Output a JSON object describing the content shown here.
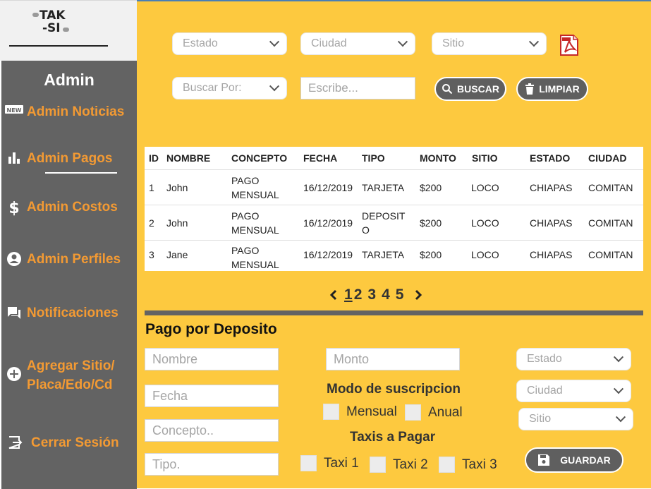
{
  "logo": {
    "line1": "TAK",
    "line2": "-SI"
  },
  "sidebar": {
    "title": "Admin",
    "items": [
      {
        "label": "Admin Noticias",
        "icon": "new-badge-icon"
      },
      {
        "label": "Admin Pagos",
        "icon": "bar-chart-icon"
      },
      {
        "label": "Admin Costos",
        "icon": "dollar-icon"
      },
      {
        "label": "Admin Perfiles",
        "icon": "account-circle-icon"
      },
      {
        "label": "Notificaciones",
        "icon": "chat-bubble-icon"
      },
      {
        "label": "Agregar Sitio/ Placa/Edo/Cd",
        "icon": "add-circle-icon"
      },
      {
        "label": "Cerrar Sesión",
        "icon": "logout-icon"
      }
    ],
    "active_index": 1
  },
  "filters": {
    "estado": "Estado",
    "ciudad": "Ciudad",
    "sitio": "Sitio",
    "buscar_por": "Buscar Por:",
    "search_placeholder": "Escribe...",
    "buscar_label": "BUSCAR",
    "limpiar_label": "LIMPIAR"
  },
  "table": {
    "headers": [
      "ID",
      "NOMBRE",
      "CONCEPTO",
      "FECHA",
      "TIPO",
      "MONTO",
      "SITIO",
      "ESTADO",
      "CIUDAD"
    ],
    "rows": [
      {
        "id": "1",
        "nombre": "John",
        "concepto_1": "PAGO",
        "concepto_2": "MENSUAL",
        "fecha": "16/12/2019",
        "tipo_1": "TARJETA",
        "tipo_2": "",
        "monto": "$200",
        "sitio": "LOCO",
        "estado": "CHIAPAS",
        "ciudad": "COMITAN"
      },
      {
        "id": "2",
        "nombre": "John",
        "concepto_1": "PAGO",
        "concepto_2": "MENSUAL",
        "fecha": "16/12/2019",
        "tipo_1": "DEPOSIT",
        "tipo_2": "O",
        "monto": "$200",
        "sitio": "LOCO",
        "estado": "CHIAPAS",
        "ciudad": "COMITAN"
      },
      {
        "id": "3",
        "nombre": "Jane",
        "concepto_1": "PAGO",
        "concepto_2": "MENSUAL",
        "fecha": "16/12/2019",
        "tipo_1": "TARJETA",
        "tipo_2": "",
        "monto": "$200",
        "sitio": "LOCO",
        "estado": "CHIAPAS",
        "ciudad": "COMITAN"
      }
    ]
  },
  "pagination": {
    "pages": [
      "1",
      "2",
      "3",
      "4",
      "5"
    ],
    "current": "1"
  },
  "form": {
    "title": "Pago por Deposito",
    "nombre": "Nombre",
    "fecha": "Fecha",
    "concepto": "Concepto..",
    "tipo": "Tipo.",
    "monto": "Monto",
    "modo_title": "Modo de suscripcion",
    "mensual": "Mensual",
    "anual": "Anual",
    "taxis_title": "Taxis a Pagar",
    "taxi1": "Taxi 1",
    "taxi2": "Taxi 2",
    "taxi3": "Taxi 3",
    "estado": "Estado",
    "ciudad": "Ciudad",
    "sitio": "Sitio",
    "guardar_label": "GUARDAR"
  },
  "colors": {
    "accent": "#fdc93f",
    "sidebar": "#636363",
    "sidebar_text": "#f39a33",
    "button": "#5f5f5f"
  }
}
